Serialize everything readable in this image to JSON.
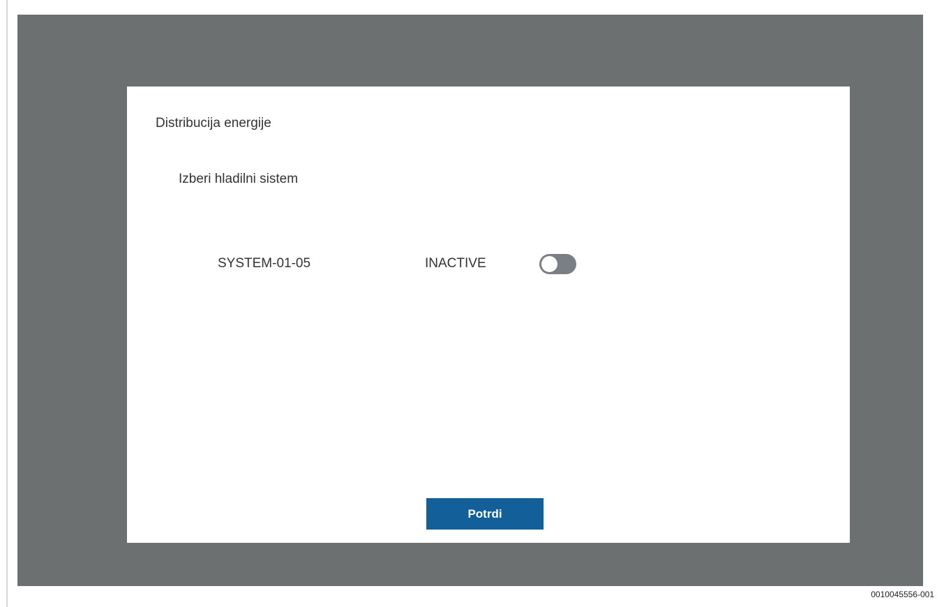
{
  "dialog": {
    "title": "Distribucija energije",
    "subtitle": "Izberi hladilni sistem",
    "systems": [
      {
        "name": "SYSTEM-01-05",
        "status": "INACTIVE",
        "toggle_on": false
      }
    ],
    "confirm_label": "Potrdi"
  },
  "figure_code": "0010045556-001",
  "colors": {
    "screen_background": "#6d7070",
    "dialog_background": "#ffffff",
    "button_background": "#135f99",
    "toggle_track_off": "#7a7e85"
  }
}
